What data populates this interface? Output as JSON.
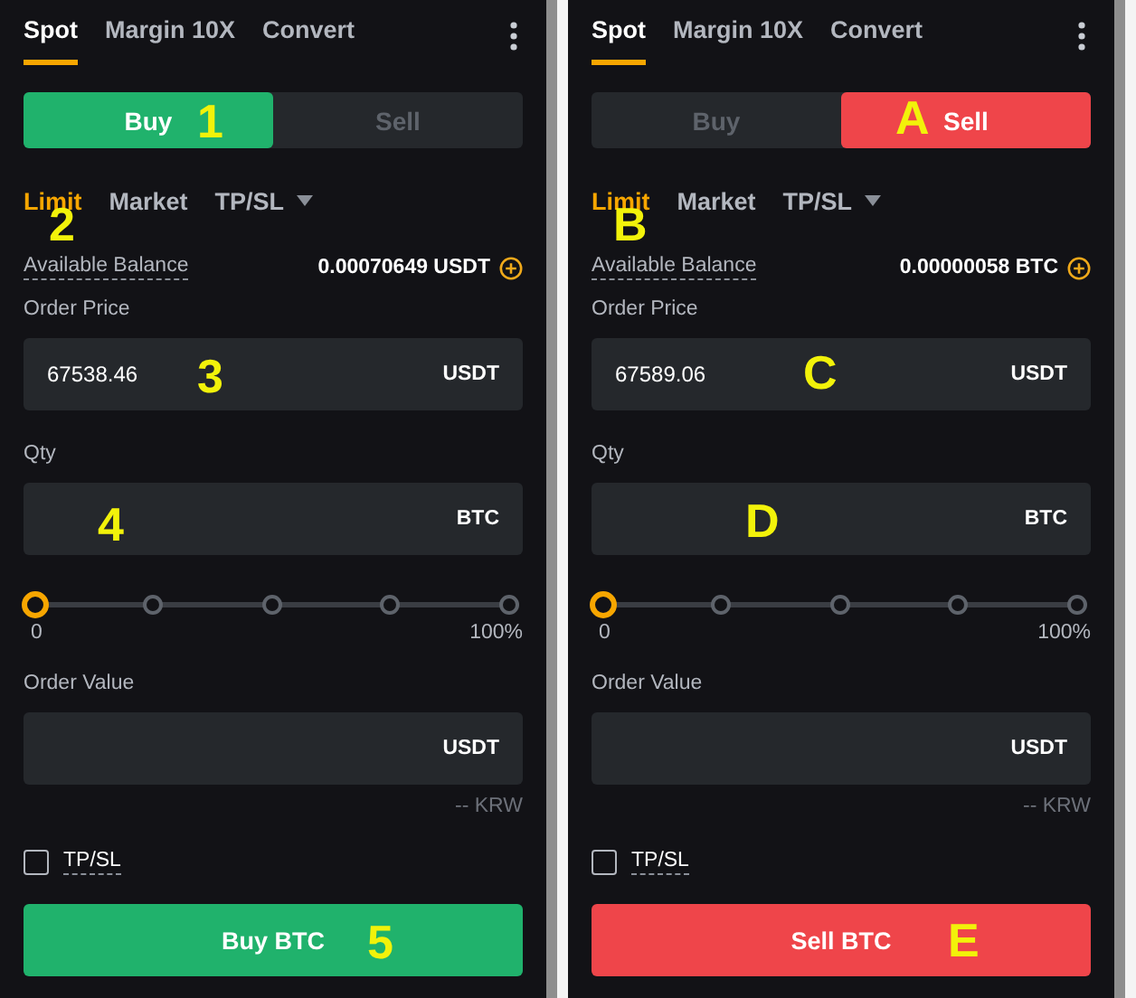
{
  "panels": [
    {
      "tabs": [
        {
          "label": "Spot",
          "selected": true
        },
        {
          "label": "Margin 10X",
          "selected": false
        },
        {
          "label": "Convert",
          "selected": false
        }
      ],
      "sides": [
        {
          "label": "Buy",
          "selected": true
        },
        {
          "label": "Sell",
          "selected": false
        }
      ],
      "side_marker": "1",
      "order_types": [
        {
          "label": "Limit",
          "selected": true
        },
        {
          "label": "Market",
          "selected": false
        },
        {
          "label": "TP/SL",
          "selected": false
        }
      ],
      "order_type_marker": "2",
      "available_balance": {
        "label": "Available Balance",
        "value": "0.00070649 USDT"
      },
      "price": {
        "label": "Order Price",
        "value": "67538.46",
        "unit": "USDT",
        "marker": "3"
      },
      "qty": {
        "label": "Qty",
        "unit": "BTC",
        "marker": "4"
      },
      "slider": {
        "level": 0,
        "min_label": "0",
        "max_label": "100%"
      },
      "order_value": {
        "label": "Order Value",
        "unit": "USDT",
        "converted": "-- KRW"
      },
      "tpsl": {
        "label": "TP/SL",
        "checked": false
      },
      "submit": {
        "label": "Buy BTC",
        "marker": "5"
      }
    },
    {
      "tabs": [
        {
          "label": "Spot",
          "selected": true
        },
        {
          "label": "Margin 10X",
          "selected": false
        },
        {
          "label": "Convert",
          "selected": false
        }
      ],
      "sides": [
        {
          "label": "Buy",
          "selected": false
        },
        {
          "label": "Sell",
          "selected": true
        }
      ],
      "side_marker": "A",
      "order_types": [
        {
          "label": "Limit",
          "selected": true
        },
        {
          "label": "Market",
          "selected": false
        },
        {
          "label": "TP/SL",
          "selected": false
        }
      ],
      "order_type_marker": "B",
      "available_balance": {
        "label": "Available Balance",
        "value": "0.00000058 BTC"
      },
      "price": {
        "label": "Order Price",
        "value": "67589.06",
        "unit": "USDT",
        "marker": "C"
      },
      "qty": {
        "label": "Qty",
        "unit": "BTC",
        "marker": "D"
      },
      "slider": {
        "level": 0,
        "min_label": "0",
        "max_label": "100%"
      },
      "order_value": {
        "label": "Order Value",
        "unit": "USDT",
        "converted": "-- KRW"
      },
      "tpsl": {
        "label": "TP/SL",
        "checked": false
      },
      "submit": {
        "label": "Sell BTC",
        "marker": "E"
      }
    }
  ]
}
